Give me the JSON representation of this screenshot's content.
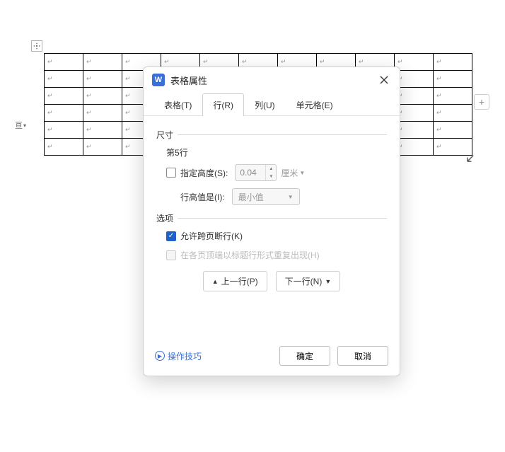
{
  "dialog": {
    "w_icon": "W",
    "title": "表格属性",
    "tabs": {
      "table": "表格(T)",
      "row": "行(R)",
      "column": "列(U)",
      "cell": "单元格(E)"
    }
  },
  "size": {
    "section_label": "尺寸",
    "row_label": "第5行",
    "specify_height_label": "指定高度(S):",
    "height_value": "0.04",
    "unit_label": "厘米",
    "row_height_is_label": "行高值是(I):",
    "row_height_mode": "最小值"
  },
  "options": {
    "section_label": "选项",
    "allow_break_label": "允许跨页断行(K)",
    "repeat_header_label": "在各页顶端以标题行形式重复出现(H)"
  },
  "nav": {
    "prev_label": "上一行(P)",
    "next_label": "下一行(N)"
  },
  "footer": {
    "tips_label": "操作技巧",
    "ok_label": "确定",
    "cancel_label": "取消"
  }
}
